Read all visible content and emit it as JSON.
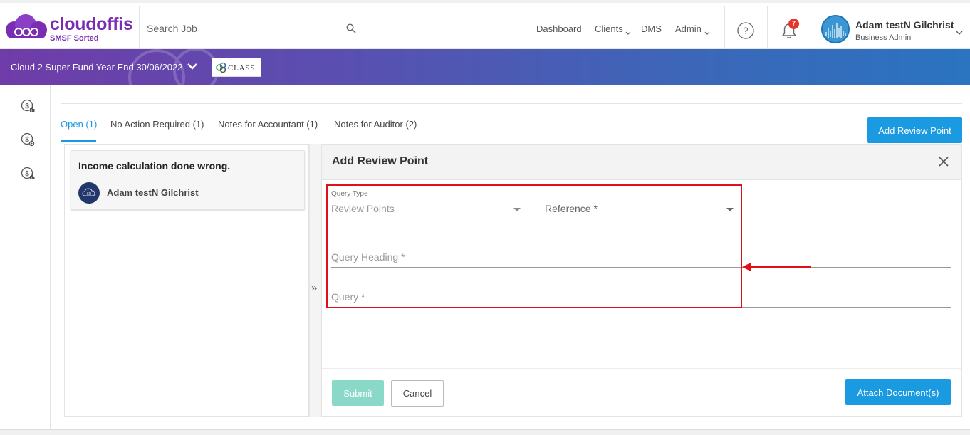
{
  "brand": {
    "name": "cloudoffis",
    "tagline": "SMSF Sorted",
    "color": "#7a2db4"
  },
  "search": {
    "placeholder": "Search Job"
  },
  "nav": {
    "items": [
      "Dashboard",
      "Clients",
      "DMS",
      "Admin"
    ]
  },
  "notifications": {
    "count": "7"
  },
  "user": {
    "name": "Adam testN Gilchrist",
    "role": "Business Admin"
  },
  "banner": {
    "fund_title": "Cloud 2 Super Fund Year End 30/06/2022",
    "software_badge": "CLASS"
  },
  "sidebar": {
    "icons": [
      "dollar-chart-icon",
      "dollar-settings-icon",
      "dollar-chart-icon"
    ]
  },
  "tabs": [
    {
      "label": "Open (1)",
      "active": true
    },
    {
      "label": "No Action Required (1)"
    },
    {
      "label": "Notes for Accountant (1)"
    },
    {
      "label": "Notes for Auditor (2)"
    }
  ],
  "add_review_point_label": "Add Review Point",
  "review_list": [
    {
      "title": "Income calculation done wrong.",
      "author": "Adam testN Gilchrist"
    }
  ],
  "collapse_glyph": "»",
  "form": {
    "title": "Add Review Point",
    "query_type": {
      "label": "Query Type",
      "value": "Review Points"
    },
    "reference": {
      "placeholder": "Reference *"
    },
    "query_heading": {
      "placeholder": "Query Heading *"
    },
    "query": {
      "placeholder": "Query *"
    },
    "submit_label": "Submit",
    "cancel_label": "Cancel",
    "attach_label": "Attach Document(s)"
  },
  "colors": {
    "accent": "#1a9ae0",
    "submit_disabled": "#8ad9c8",
    "annotation": "#e0101a",
    "badge": "#e8352b"
  }
}
